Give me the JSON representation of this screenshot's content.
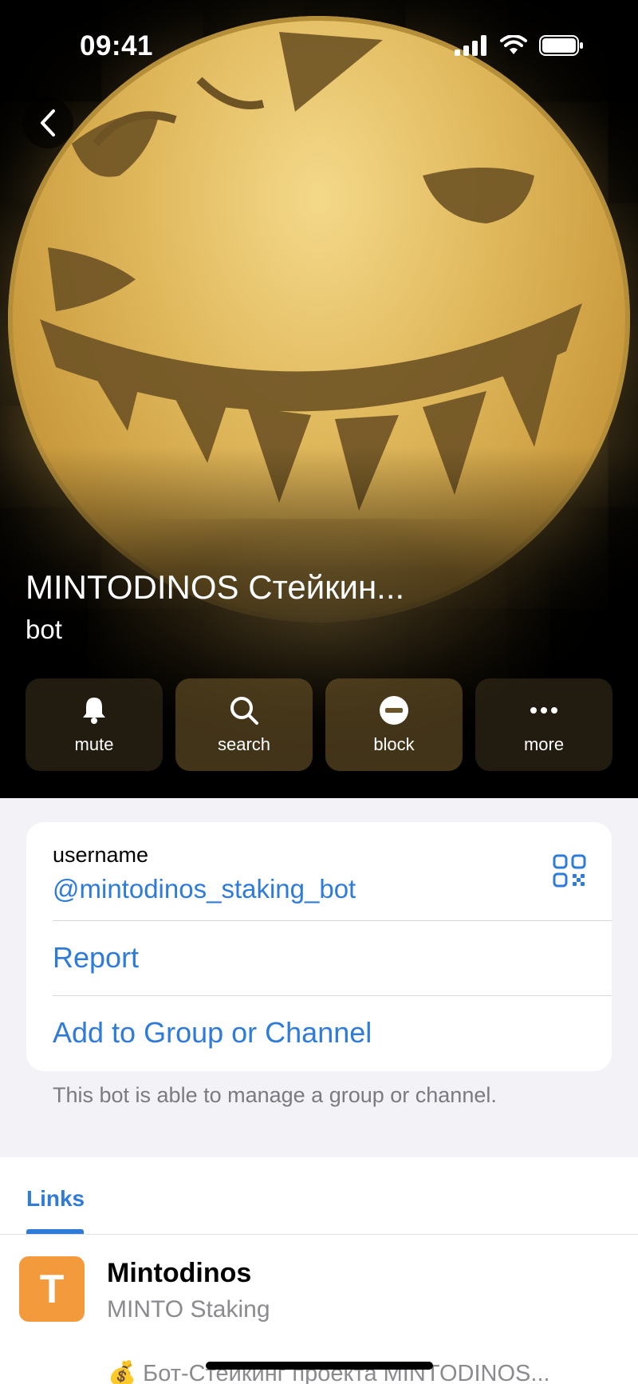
{
  "status_bar": {
    "time": "09:41",
    "icons": [
      "cellular-signal-icon",
      "wifi-icon",
      "battery-icon"
    ]
  },
  "profile": {
    "name": "MINTODINOS Стейкин...",
    "subtitle": "bot",
    "accent_gold": "#e0b85c"
  },
  "actions": [
    {
      "label": "mute",
      "icon": "bell-icon"
    },
    {
      "label": "search",
      "icon": "magnifier-icon"
    },
    {
      "label": "block",
      "icon": "block-icon"
    },
    {
      "label": "more",
      "icon": "more-dots-icon"
    }
  ],
  "info_card": {
    "username_label": "username",
    "username_value": "@mintodinos_staking_bot",
    "report": "Report",
    "add_to_group": "Add to Group or Channel"
  },
  "footer_note": "This bot is able to manage a group or channel.",
  "links": {
    "tab_label": "Links",
    "items": [
      {
        "avatar_letter": "T",
        "title": "Mintodinos",
        "subtitle": "MINTO Staking",
        "description": "💰 Бот-Стейкинг проекта MINTODINOS..."
      }
    ]
  },
  "colors": {
    "link_blue": "#2f7bd9",
    "avatar_orange": "#f29a3c",
    "background": "#f2f2f7"
  }
}
